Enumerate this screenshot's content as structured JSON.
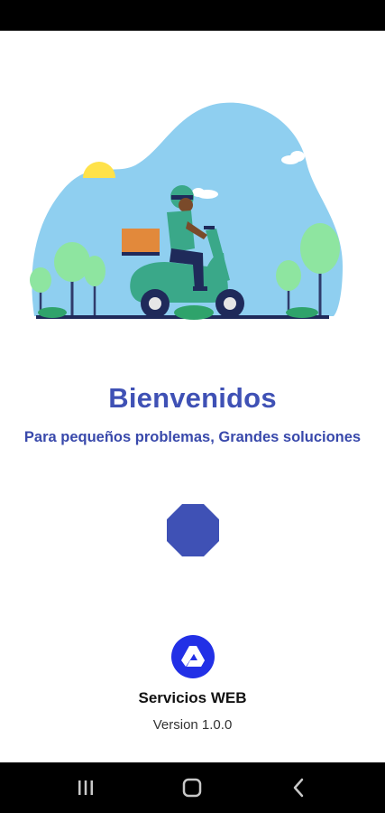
{
  "welcome": {
    "title": "Bienvenidos",
    "subtitle": "Para pequeños problemas, Grandes soluciones"
  },
  "footer": {
    "company": "Servicios WEB",
    "version": "Version 1.0.0"
  },
  "navigation": {
    "buttons": [
      "recent-apps-icon",
      "home-icon",
      "back-icon"
    ]
  },
  "colors": {
    "primary": "#3f51b5",
    "sky": "#8fcff0",
    "scooter": "#3aa889",
    "tree": "#8ee5a0",
    "box": "#e2893b",
    "sun": "#ffe24a"
  }
}
